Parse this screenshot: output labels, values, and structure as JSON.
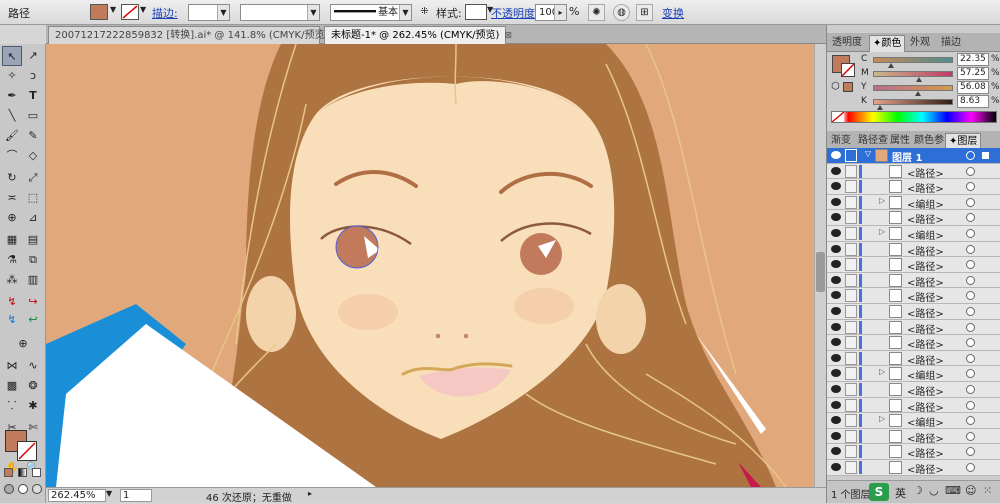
{
  "control_bar": {
    "object_type": "路径",
    "stroke_label": "描边:",
    "stroke_weight": "",
    "stroke_style": "基本",
    "style_label": "样式:",
    "opacity_label": "不透明度:",
    "opacity_value": "100",
    "percent": "%",
    "transform_label": "变换"
  },
  "colors": {
    "fill": "#c17a5c",
    "skin": "#f9deba",
    "hair": "#ad7442",
    "background": "#e1a97b",
    "accent_blue": "#1a8fd8",
    "layer_select": "#2d6fd6"
  },
  "doc_tabs": [
    {
      "label": "20071217222859832 [转换].ai* @ 141.8% (CMYK/预览)"
    },
    {
      "label": "未标题-1* @ 262.45% (CMYK/预览)"
    }
  ],
  "panel_tabs_top": [
    "透明度",
    "颜色",
    "外观",
    "描边"
  ],
  "color_panel": {
    "channels": [
      {
        "name": "C",
        "value": "22.35",
        "pos": 0.22
      },
      {
        "name": "M",
        "value": "57.25",
        "pos": 0.57
      },
      {
        "name": "Y",
        "value": "56.08",
        "pos": 0.56
      },
      {
        "name": "K",
        "value": "8.63",
        "pos": 0.09
      }
    ],
    "percent": "%"
  },
  "panel_tabs_bottom": [
    "渐变",
    "路径查",
    "属性",
    "颜色参",
    "图层"
  ],
  "layers": {
    "top": "图层 1",
    "items": [
      {
        "name": "<路径>",
        "arrow": ""
      },
      {
        "name": "<路径>",
        "arrow": ""
      },
      {
        "name": "<编组>",
        "arrow": "▷"
      },
      {
        "name": "<路径>",
        "arrow": ""
      },
      {
        "name": "<编组>",
        "arrow": "▷"
      },
      {
        "name": "<路径>",
        "arrow": ""
      },
      {
        "name": "<路径>",
        "arrow": ""
      },
      {
        "name": "<路径>",
        "arrow": ""
      },
      {
        "name": "<路径>",
        "arrow": ""
      },
      {
        "name": "<路径>",
        "arrow": ""
      },
      {
        "name": "<路径>",
        "arrow": ""
      },
      {
        "name": "<路径>",
        "arrow": ""
      },
      {
        "name": "<路径>",
        "arrow": ""
      },
      {
        "name": "<编组>",
        "arrow": "▷"
      },
      {
        "name": "<路径>",
        "arrow": ""
      },
      {
        "name": "<路径>",
        "arrow": ""
      },
      {
        "name": "<编组>",
        "arrow": "▷"
      },
      {
        "name": "<路径>",
        "arrow": ""
      },
      {
        "name": "<路径>",
        "arrow": ""
      },
      {
        "name": "<路径>",
        "arrow": ""
      }
    ],
    "count_label": "1 个图层"
  },
  "status_bar": {
    "zoom": "262.45%",
    "page": "1",
    "history": "46 次还原；无重做"
  },
  "ime": {
    "label": "英"
  }
}
